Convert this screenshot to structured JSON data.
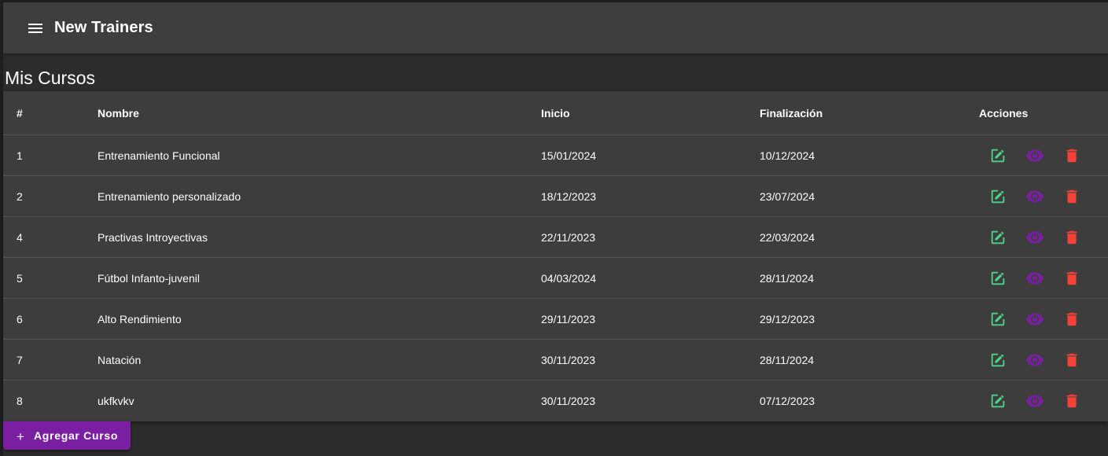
{
  "appbar": {
    "title": "New Trainers",
    "menu_icon": "menu-icon"
  },
  "page": {
    "title": "Mis Cursos"
  },
  "table": {
    "headers": {
      "num": "#",
      "name": "Nombre",
      "start": "Inicio",
      "end": "Finalización",
      "actions": "Acciones"
    },
    "rows": [
      {
        "num": "1",
        "name": "Entrenamiento Funcional",
        "start": "15/01/2024",
        "end": "10/12/2024"
      },
      {
        "num": "2",
        "name": "Entrenamiento personalizado",
        "start": "18/12/2023",
        "end": "23/07/2024"
      },
      {
        "num": "4",
        "name": "Practivas Introyectivas",
        "start": "22/11/2023",
        "end": "22/03/2024"
      },
      {
        "num": "5",
        "name": "Fútbol Infanto-juvenil",
        "start": "04/03/2024",
        "end": "28/11/2024"
      },
      {
        "num": "6",
        "name": "Alto Rendimiento",
        "start": "29/11/2023",
        "end": "29/12/2023"
      },
      {
        "num": "7",
        "name": "Natación",
        "start": "30/11/2023",
        "end": "28/11/2024"
      },
      {
        "num": "8",
        "name": "ukfkvkv",
        "start": "30/11/2023",
        "end": "07/12/2023"
      }
    ],
    "action_icons": {
      "edit": "edit-icon",
      "view": "eye-icon",
      "delete": "trash-icon"
    }
  },
  "add_button": {
    "label": "Agregar Curso",
    "icon": "plus-icon"
  },
  "colors": {
    "edit": "#4fd18b",
    "view": "#7b1fa2",
    "delete": "#f44336",
    "add_button": "#7b1fa2"
  }
}
